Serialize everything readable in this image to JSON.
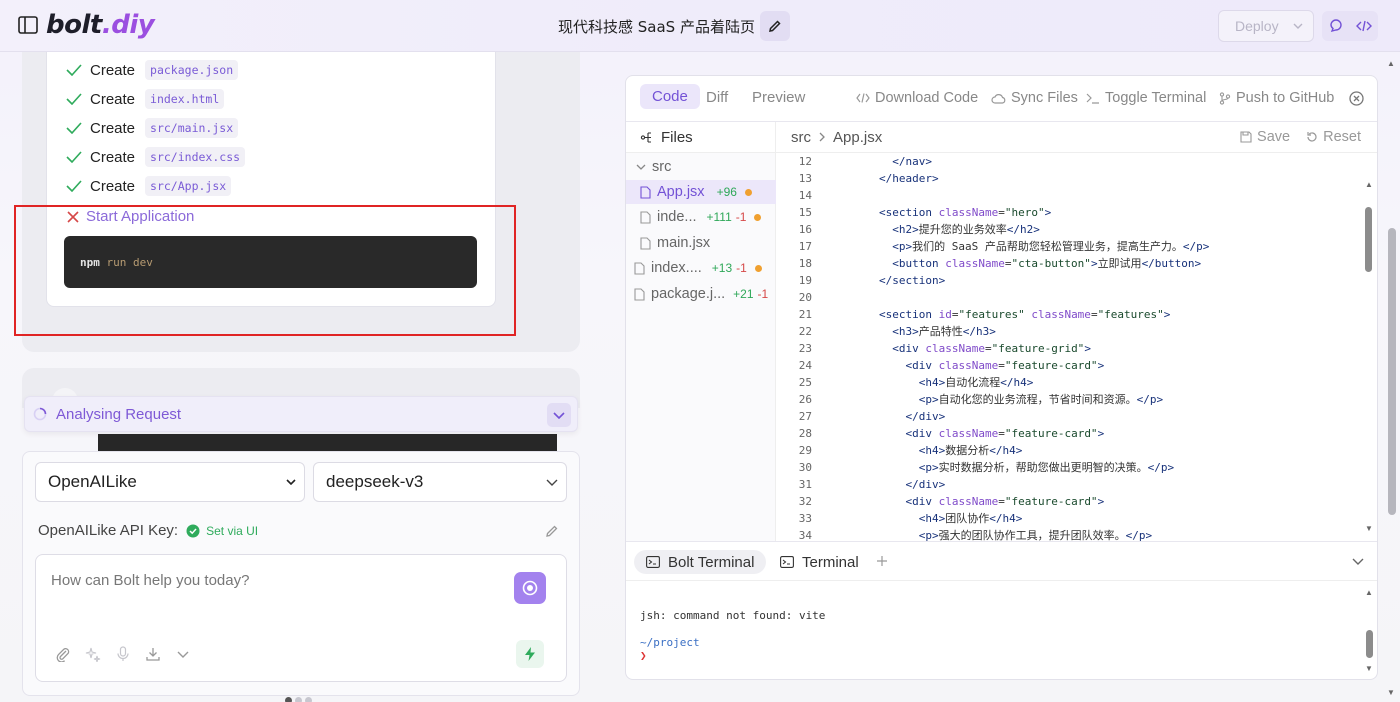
{
  "header": {
    "logo_main": "bolt",
    "logo_dot": ".",
    "logo_suffix": "diy",
    "chat_title": "现代科技感 SaaS 产品着陆页",
    "deploy_label": "Deploy"
  },
  "artifact": {
    "actions": [
      {
        "verb": "Create",
        "file": "package.json"
      },
      {
        "verb": "Create",
        "file": "index.html"
      },
      {
        "verb": "Create",
        "file": "src/main.jsx"
      },
      {
        "verb": "Create",
        "file": "src/index.css"
      },
      {
        "verb": "Create",
        "file": "src/App.jsx"
      }
    ],
    "start_label": "Start Application",
    "command": {
      "bin": "npm",
      "args": "run dev"
    }
  },
  "progress": {
    "label": "Analysing Request"
  },
  "input": {
    "provider": "OpenAILike",
    "model": "deepseek-v3",
    "api_key_label": "OpenAILike API Key:",
    "api_key_status": "Set via UI",
    "placeholder": "How can Bolt help you today?"
  },
  "workbench": {
    "tabs": [
      "Code",
      "Diff",
      "Preview"
    ],
    "active_tab": "Code",
    "actions": [
      "Download Code",
      "Sync Files",
      "Toggle Terminal",
      "Push to GitHub"
    ],
    "files_label": "Files",
    "tree": [
      {
        "name": "src",
        "added": "",
        "removed": "",
        "modified": false
      },
      {
        "name": "App.jsx",
        "added": "+96",
        "removed": "",
        "modified": true
      },
      {
        "name": "inde...",
        "added": "+111",
        "removed": "-1",
        "modified": true
      },
      {
        "name": "main.jsx",
        "added": "",
        "removed": "",
        "modified": false
      },
      {
        "name": "index....",
        "added": "+13",
        "removed": "-1",
        "modified": true
      },
      {
        "name": "package.j...",
        "added": "+21",
        "removed": "-1",
        "modified": false
      }
    ],
    "breadcrumb": [
      "src",
      "App.jsx"
    ],
    "save_label": "Save",
    "reset_label": "Reset",
    "code_lines": [
      {
        "n": "12",
        "t": "          </nav>"
      },
      {
        "n": "13",
        "t": "        </header>"
      },
      {
        "n": "14",
        "t": ""
      },
      {
        "n": "15",
        "t": "        <section className=\"hero\">"
      },
      {
        "n": "16",
        "t": "          <h2>提升您的业务效率</h2>"
      },
      {
        "n": "17",
        "t": "          <p>我们的 SaaS 产品帮助您轻松管理业务，提高生产力。</p>"
      },
      {
        "n": "18",
        "t": "          <button className=\"cta-button\">立即试用</button>"
      },
      {
        "n": "19",
        "t": "        </section>"
      },
      {
        "n": "20",
        "t": ""
      },
      {
        "n": "21",
        "t": "        <section id=\"features\" className=\"features\">"
      },
      {
        "n": "22",
        "t": "          <h3>产品特性</h3>"
      },
      {
        "n": "23",
        "t": "          <div className=\"feature-grid\">"
      },
      {
        "n": "24",
        "t": "            <div className=\"feature-card\">"
      },
      {
        "n": "25",
        "t": "              <h4>自动化流程</h4>"
      },
      {
        "n": "26",
        "t": "              <p>自动化您的业务流程，节省时间和资源。</p>"
      },
      {
        "n": "27",
        "t": "            </div>"
      },
      {
        "n": "28",
        "t": "            <div className=\"feature-card\">"
      },
      {
        "n": "29",
        "t": "              <h4>数据分析</h4>"
      },
      {
        "n": "30",
        "t": "              <p>实时数据分析，帮助您做出更明智的决策。</p>"
      },
      {
        "n": "31",
        "t": "            </div>"
      },
      {
        "n": "32",
        "t": "            <div className=\"feature-card\">"
      },
      {
        "n": "33",
        "t": "              <h4>团队协作</h4>"
      },
      {
        "n": "34",
        "t": "              <p>强大的团队协作工具，提升团队效率。</p>"
      }
    ],
    "terminal_tabs": [
      "Bolt Terminal",
      "Terminal"
    ],
    "terminal_lines": {
      "error": "jsh: command not found: vite",
      "path": "~/project",
      "prompt": "❯"
    }
  },
  "colors": {
    "accent": "#7352d6",
    "send_button": "#a382ee",
    "error_highlight": "#e02424",
    "success": "#2fab5c"
  }
}
